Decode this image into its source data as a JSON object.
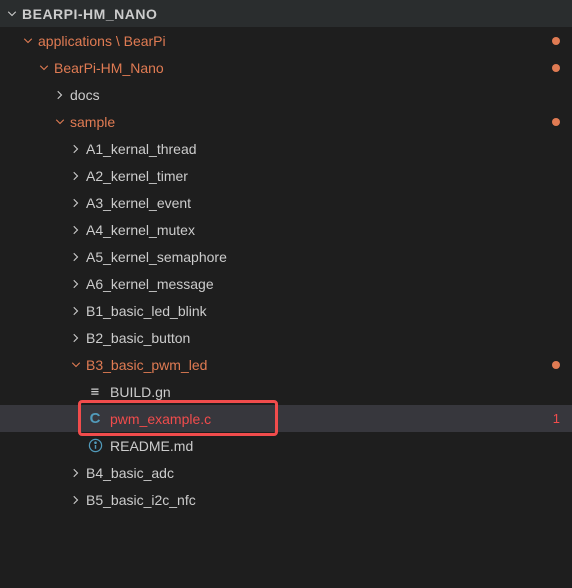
{
  "header": {
    "title": "BEARPI-HM_NANO"
  },
  "tree": {
    "applications": {
      "label": "applications \\ BearPi",
      "bearpi_hm_nano": {
        "label": "BearPi-HM_Nano",
        "docs": {
          "label": "docs"
        },
        "sample": {
          "label": "sample",
          "items": [
            {
              "label": "A1_kernal_thread",
              "type": "folder"
            },
            {
              "label": "A2_kernel_timer",
              "type": "folder"
            },
            {
              "label": "A3_kernel_event",
              "type": "folder"
            },
            {
              "label": "A4_kernel_mutex",
              "type": "folder"
            },
            {
              "label": "A5_kernel_semaphore",
              "type": "folder"
            },
            {
              "label": "A6_kernel_message",
              "type": "folder"
            },
            {
              "label": "B1_basic_led_blink",
              "type": "folder"
            },
            {
              "label": "B2_basic_button",
              "type": "folder"
            }
          ],
          "b3": {
            "label": "B3_basic_pwm_led",
            "files": [
              {
                "label": "BUILD.gn",
                "icon": "build"
              },
              {
                "label": "pwm_example.c",
                "icon": "c",
                "errors": "1",
                "selected": true
              },
              {
                "label": "README.md",
                "icon": "info"
              }
            ]
          },
          "rest": [
            {
              "label": "B4_basic_adc",
              "type": "folder"
            },
            {
              "label": "B5_basic_i2c_nfc",
              "type": "folder"
            }
          ]
        }
      }
    }
  }
}
